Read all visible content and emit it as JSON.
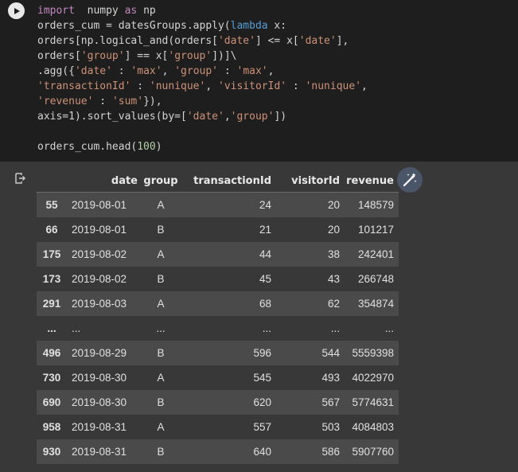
{
  "code_lines": [
    [
      [
        "kw",
        "import"
      ],
      [
        "",
        "  numpy "
      ],
      [
        "kw",
        "as"
      ],
      [
        "",
        " np"
      ]
    ],
    [
      [
        "",
        "orders_cum = datesGroups.apply("
      ],
      [
        "kw2",
        "lambda"
      ],
      [
        "",
        " x:"
      ]
    ],
    [
      [
        "",
        "orders[np.logical_and(orders["
      ],
      [
        "str",
        "'date'"
      ],
      [
        "",
        "] <= x["
      ],
      [
        "str",
        "'date'"
      ],
      [
        "",
        "],"
      ]
    ],
    [
      [
        "",
        "orders["
      ],
      [
        "str",
        "'group'"
      ],
      [
        "",
        "] == x["
      ],
      [
        "str",
        "'group'"
      ],
      [
        "",
        "])]\\"
      ]
    ],
    [
      [
        "",
        ".agg({"
      ],
      [
        "str",
        "'date'"
      ],
      [
        "",
        " : "
      ],
      [
        "str",
        "'max'"
      ],
      [
        "",
        ", "
      ],
      [
        "str",
        "'group'"
      ],
      [
        "",
        " : "
      ],
      [
        "str",
        "'max'"
      ],
      [
        "",
        ","
      ]
    ],
    [
      [
        "str",
        "'transactionId'"
      ],
      [
        "",
        " : "
      ],
      [
        "str",
        "'nunique'"
      ],
      [
        "",
        ", "
      ],
      [
        "str",
        "'visitorId'"
      ],
      [
        "",
        " : "
      ],
      [
        "str",
        "'nunique'"
      ],
      [
        "",
        ","
      ]
    ],
    [
      [
        "str",
        "'revenue'"
      ],
      [
        "",
        " : "
      ],
      [
        "str",
        "'sum'"
      ],
      [
        "",
        "}),"
      ]
    ],
    [
      [
        "",
        "axis=1).sort_values(by=["
      ],
      [
        "str",
        "'date'"
      ],
      [
        "",
        ","
      ],
      [
        "str",
        "'group'"
      ],
      [
        "",
        "])"
      ]
    ],
    [
      [
        "",
        ""
      ]
    ],
    [
      [
        "",
        "orders_cum.head("
      ],
      [
        "num",
        "100"
      ],
      [
        "",
        ")"
      ]
    ]
  ],
  "table": {
    "columns": [
      "date",
      "group",
      "transactionId",
      "visitorId",
      "revenue"
    ],
    "rows": [
      {
        "idx": "55",
        "date": "2019-08-01",
        "group": "A",
        "tx": "24",
        "vis": "20",
        "rev": "148579"
      },
      {
        "idx": "66",
        "date": "2019-08-01",
        "group": "B",
        "tx": "21",
        "vis": "20",
        "rev": "101217"
      },
      {
        "idx": "175",
        "date": "2019-08-02",
        "group": "A",
        "tx": "44",
        "vis": "38",
        "rev": "242401"
      },
      {
        "idx": "173",
        "date": "2019-08-02",
        "group": "B",
        "tx": "45",
        "vis": "43",
        "rev": "266748"
      },
      {
        "idx": "291",
        "date": "2019-08-03",
        "group": "A",
        "tx": "68",
        "vis": "62",
        "rev": "354874"
      },
      {
        "idx": "...",
        "date": "...",
        "group": "...",
        "tx": "...",
        "vis": "...",
        "rev": "..."
      },
      {
        "idx": "496",
        "date": "2019-08-29",
        "group": "B",
        "tx": "596",
        "vis": "544",
        "rev": "5559398"
      },
      {
        "idx": "730",
        "date": "2019-08-30",
        "group": "A",
        "tx": "545",
        "vis": "493",
        "rev": "4022970"
      },
      {
        "idx": "690",
        "date": "2019-08-30",
        "group": "B",
        "tx": "620",
        "vis": "567",
        "rev": "5774631"
      },
      {
        "idx": "958",
        "date": "2019-08-31",
        "group": "A",
        "tx": "557",
        "vis": "503",
        "rev": "4084803"
      },
      {
        "idx": "930",
        "date": "2019-08-31",
        "group": "B",
        "tx": "640",
        "vis": "586",
        "rev": "5907760"
      }
    ]
  },
  "icons": {
    "run": "play-icon",
    "output": "output-arrow-icon",
    "magic": "magic-wand-icon"
  },
  "colors": {
    "code_bg": "#1e1e1e",
    "output_bg": "#383838",
    "keyword": "#c586c0",
    "string": "#ce9178",
    "number": "#b5cea8"
  }
}
